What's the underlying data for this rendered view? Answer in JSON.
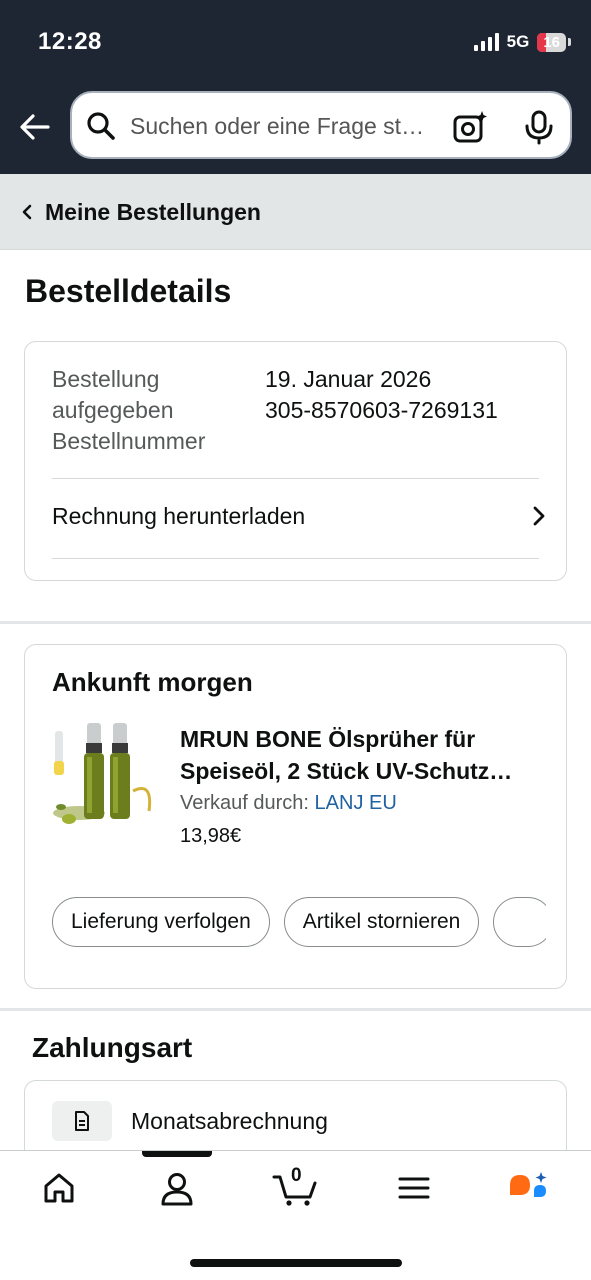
{
  "status_bar": {
    "time": "12:28",
    "network": "5G",
    "battery": "16"
  },
  "search": {
    "placeholder": "Suchen oder eine Frage stellen"
  },
  "breadcrumb": {
    "label": "Meine Bestellungen"
  },
  "page": {
    "title": "Bestelldetails"
  },
  "order_info": {
    "label_line1": "Bestellung",
    "label_line2": "aufgegeben",
    "label_line3": "Bestellnummer",
    "date": "19. Januar 2026",
    "order_number": "305-8570603-7269131",
    "invoice_label": "Rechnung herunterladen"
  },
  "shipment": {
    "heading": "Ankunft morgen",
    "product_title": "MRUN BONE Ölsprüher für Speiseöl, 2 Stück UV-Schutz…",
    "seller_prefix": "Verkauf durch:",
    "seller_name": "LANJ EU",
    "price": "13,98€",
    "actions": [
      "Lieferung verfolgen",
      "Artikel stornieren"
    ]
  },
  "payment": {
    "heading": "Zahlungsart",
    "method": "Monatsabrechnung"
  },
  "tabbar": {
    "cart_count": "0"
  },
  "colors": {
    "header_bg": "#1f2633",
    "link": "#2162a1",
    "battery_low": "#e5364a",
    "rufus_orange": "#ff6a13",
    "rufus_blue": "#1a8cff"
  }
}
